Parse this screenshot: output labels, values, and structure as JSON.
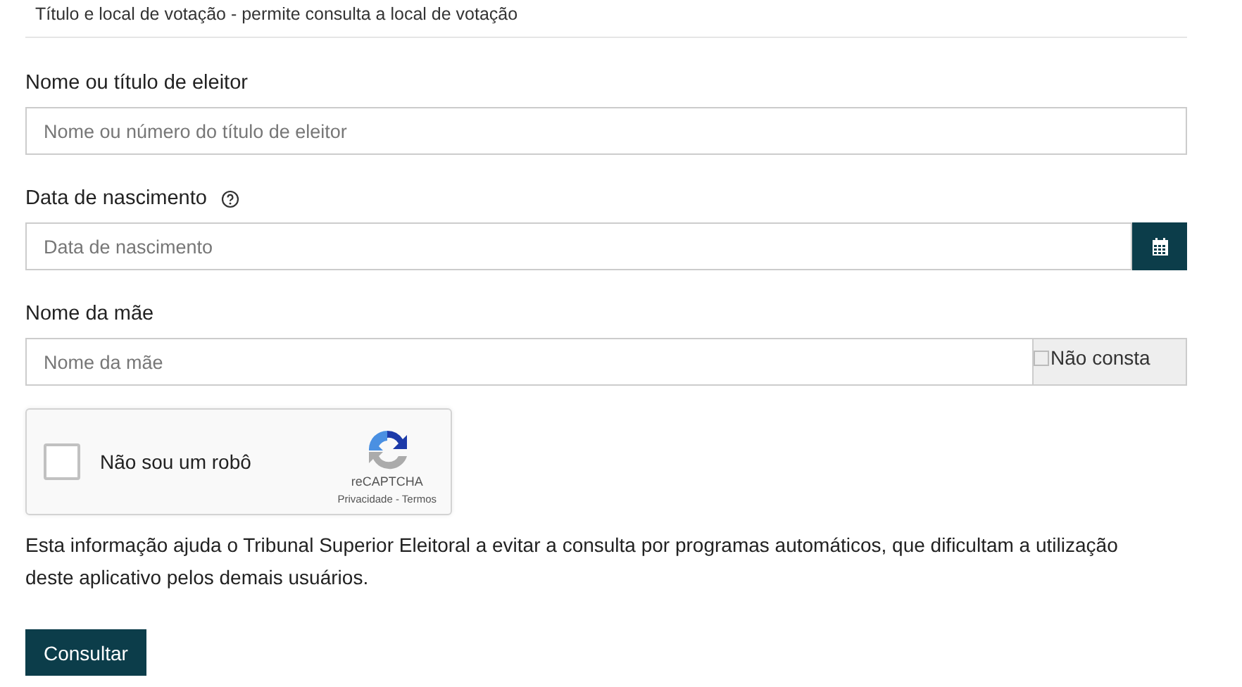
{
  "header": "Título e local de votação - permite consulta a local de votação",
  "fields": [
    {
      "kind": "text",
      "label": "Nome ou título de eleitor",
      "placeholder": "Nome ou número do título de eleitor",
      "help": false
    },
    {
      "kind": "date",
      "label": "Data de nascimento",
      "placeholder": "Data de nascimento",
      "help": true
    },
    {
      "kind": "optional",
      "label": "Nome da mãe",
      "placeholder": "Nome da mãe",
      "help": false,
      "option": {
        "label": "Não consta",
        "checked": false
      }
    }
  ],
  "captcha": {
    "label": "Não sou um robô",
    "checked": false,
    "brand": "reCAPTCHA",
    "links": "Privacidade - Termos"
  },
  "info": "Esta informação ajuda o Tribunal Superior Eleitoral a evitar a consulta por programas automáticos, que dificultam a utilização deste aplicativo pelos demais usuários.",
  "submit": "Consultar"
}
